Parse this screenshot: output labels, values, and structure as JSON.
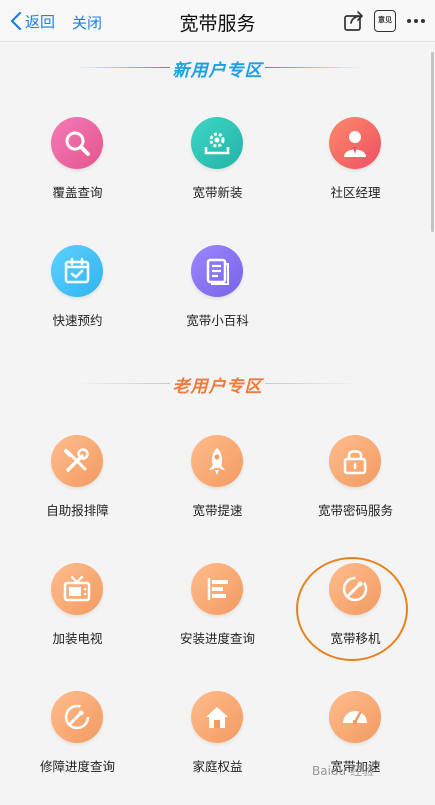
{
  "header": {
    "back_label": "返回",
    "close_label": "关闭",
    "title": "宽带服务",
    "feedback_label": "意见"
  },
  "sections": {
    "new_users": {
      "title": "新用户专区",
      "color": "#1aa0e6"
    },
    "old_users": {
      "title": "老用户专区",
      "color": "#f07a3c"
    }
  },
  "tiles": [
    {
      "label": "覆盖查询",
      "icon": "magnifier-icon"
    },
    {
      "label": "宽带新装",
      "icon": "gear-install-icon"
    },
    {
      "label": "社区经理",
      "icon": "manager-icon"
    },
    {
      "label": "快速预约",
      "icon": "calendar-icon"
    },
    {
      "label": "宽带小百科",
      "icon": "book-icon"
    },
    {
      "label": "自助报排障",
      "icon": "tools-icon"
    },
    {
      "label": "宽带提速",
      "icon": "rocket-icon"
    },
    {
      "label": "宽带密码服务",
      "icon": "lock-icon"
    },
    {
      "label": "加装电视",
      "icon": "tv-icon"
    },
    {
      "label": "安装进度查询",
      "icon": "progress-icon"
    },
    {
      "label": "宽带移机",
      "icon": "relocation-icon"
    },
    {
      "label": "修障进度查询",
      "icon": "repair-gauge-icon"
    },
    {
      "label": "家庭权益",
      "icon": "home-icon"
    },
    {
      "label": "宽带加速",
      "icon": "speedometer-icon"
    }
  ],
  "watermark": "Baidu 经验"
}
